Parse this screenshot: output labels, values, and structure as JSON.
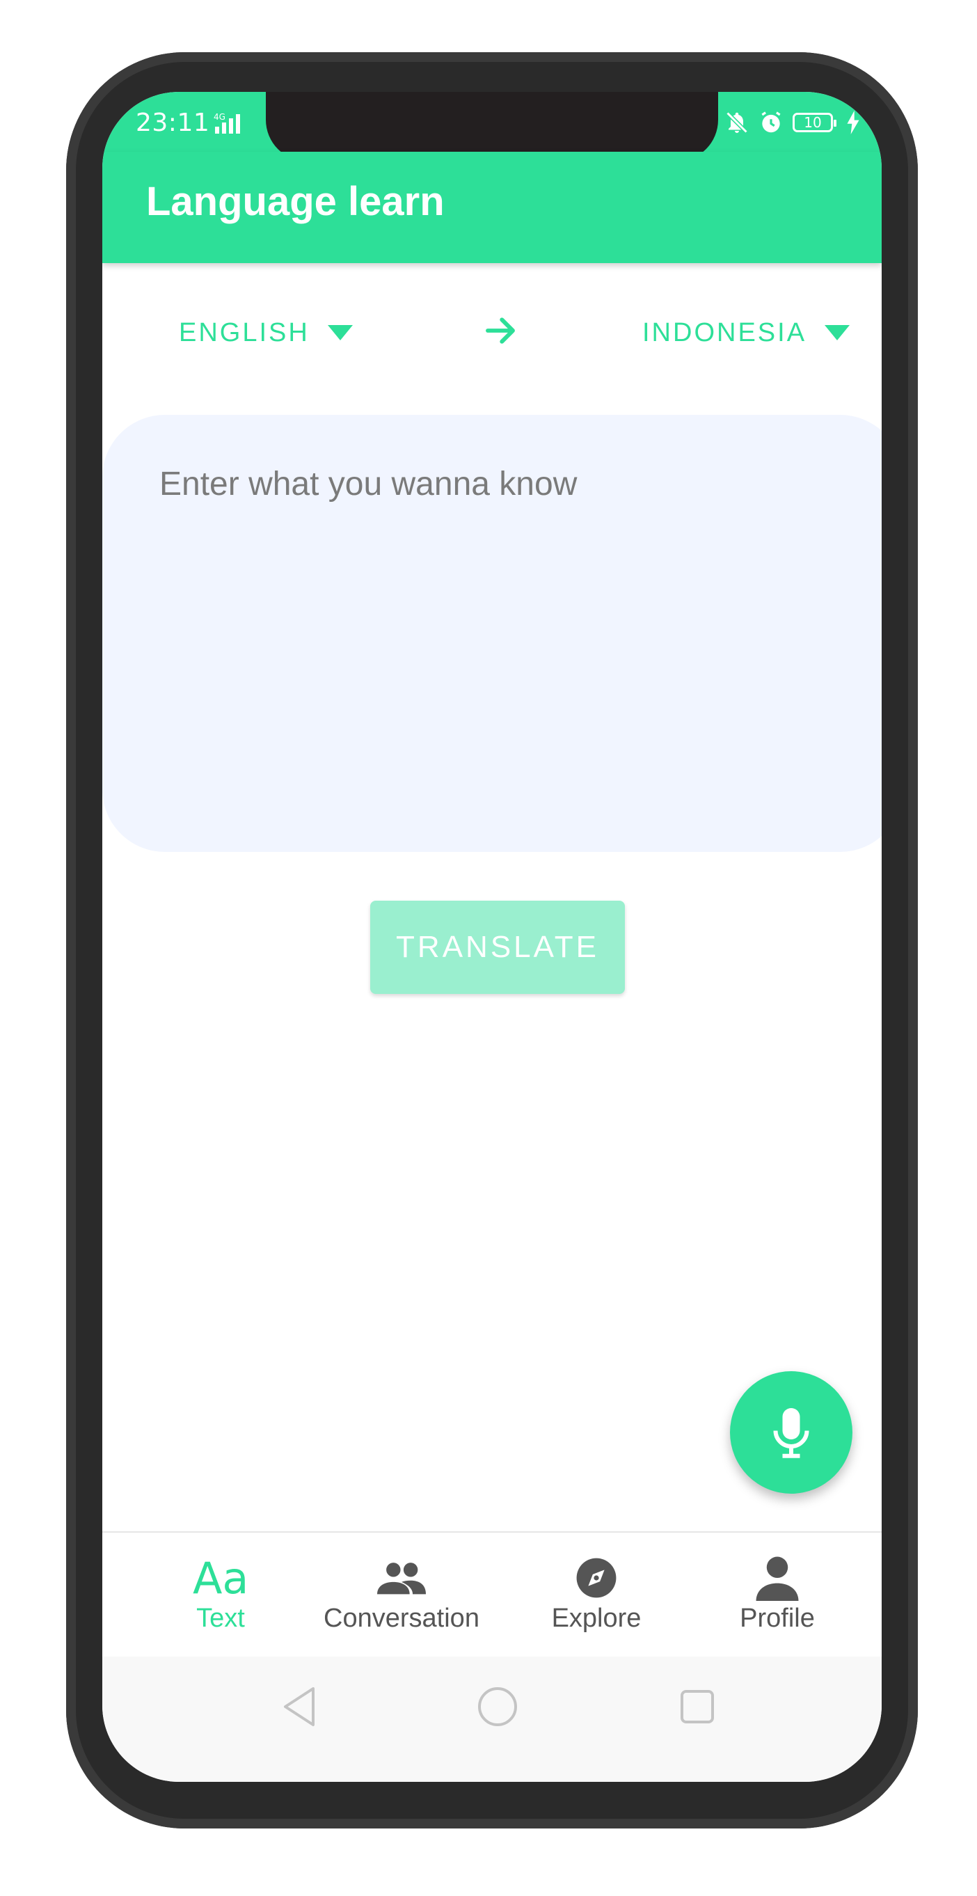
{
  "status_bar": {
    "time": "23:11",
    "network": "4G",
    "battery": "10"
  },
  "app": {
    "title": "Language learn"
  },
  "languages": {
    "from": "ENGLISH",
    "to": "INDONESIA"
  },
  "input": {
    "placeholder": "Enter what you wanna know",
    "value": ""
  },
  "translate_button": {
    "label": "TRANSLATE"
  },
  "bottom_nav": {
    "items": [
      {
        "label": "Text",
        "icon": "text-aa-icon",
        "active": true
      },
      {
        "label": "Conversation",
        "icon": "people-icon",
        "active": false
      },
      {
        "label": "Explore",
        "icon": "compass-icon",
        "active": false
      },
      {
        "label": "Profile",
        "icon": "person-icon",
        "active": false
      }
    ]
  },
  "colors": {
    "primary": "#2ddf98",
    "button_disabled": "#9aefcf",
    "input_bg": "#f1f5ff",
    "nav_inactive": "#555555"
  }
}
